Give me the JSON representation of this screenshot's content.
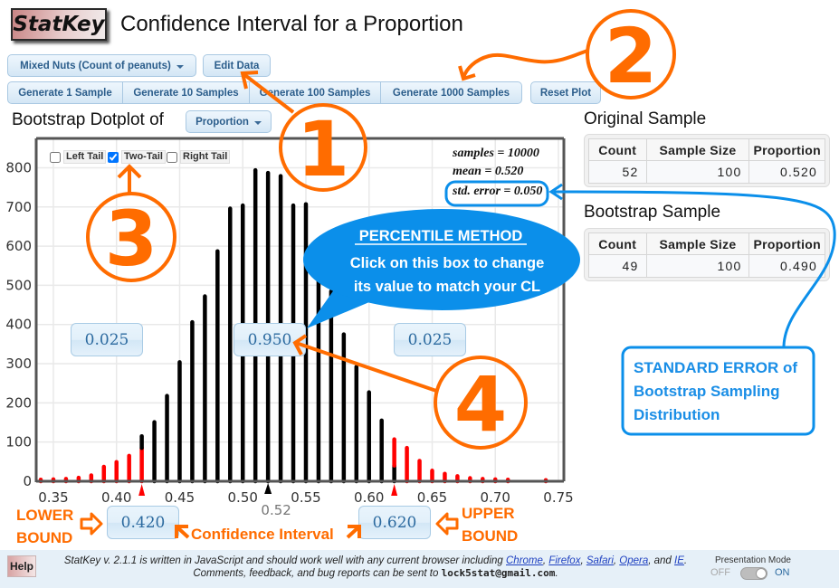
{
  "header": {
    "logo": "StatKey",
    "title": "Confidence Interval for a Proportion"
  },
  "toolbar": {
    "dataset": "Mixed Nuts (Count of peanuts)",
    "edit_data": "Edit Data",
    "generate": [
      "Generate 1 Sample",
      "Generate 10 Samples",
      "Generate 100 Samples",
      "Generate 1000 Samples"
    ],
    "reset_plot": "Reset Plot"
  },
  "plot_header": {
    "label": "Bootstrap Dotplot of",
    "statistic": "Proportion"
  },
  "tail_options": [
    {
      "label": "Left Tail",
      "checked": false
    },
    {
      "label": "Two-Tail",
      "checked": true
    },
    {
      "label": "Right Tail",
      "checked": false
    }
  ],
  "stats": {
    "samples": "samples = 10000",
    "mean": "mean = 0.520",
    "std_error": "std. error = 0.050"
  },
  "interval_boxes": {
    "left_tail": "0.025",
    "center": "0.950",
    "right_tail": "0.025",
    "lower_bound": "0.420",
    "upper_bound": "0.620"
  },
  "original_sample": {
    "title": "Original Sample",
    "headers": [
      "Count",
      "Sample Size",
      "Proportion"
    ],
    "values": [
      "52",
      "100",
      "0.520"
    ]
  },
  "bootstrap_sample": {
    "title": "Bootstrap Sample",
    "headers": [
      "Count",
      "Sample Size",
      "Proportion"
    ],
    "values": [
      "49",
      "100",
      "0.490"
    ]
  },
  "annotations": {
    "step_numbers": [
      "1",
      "2",
      "3",
      "4"
    ],
    "bubble_title": "PERCENTILE METHOD",
    "bubble_lines": [
      "Click on this box to change",
      "its value to match your CL"
    ],
    "se_callout": [
      "STANDARD ERROR of",
      "Bootstrap Sampling",
      "Distribution"
    ],
    "lower_bound": [
      "LOWER",
      "BOUND"
    ],
    "upper_bound": [
      "UPPER",
      "BOUND"
    ],
    "confidence_interval": "Confidence Interval"
  },
  "footer": {
    "help": "Help",
    "line1_prefix": "StatKey v. 2.1.1 is written in JavaScript and should work well with any current browser including ",
    "browsers": [
      "Chrome",
      "Firefox",
      "Safari",
      "Opera",
      "IE"
    ],
    "sep": ", ",
    "last_sep": ", and ",
    "end": ".",
    "line2_prefix": "Comments, feedback, and bug reports can be sent to ",
    "email": "lock5stat@gmail.com",
    "presentation_mode_label": "Presentation Mode",
    "off_label": "OFF",
    "on_label": "ON",
    "presentation_mode": "off"
  },
  "colors": {
    "annotation_orange": "#ff6c00",
    "callout_blue": "#0b8fea",
    "tail_red": "#ff0000",
    "interval_black": "#000000",
    "button_text": "#2b5d8b"
  },
  "chart_data": {
    "type": "bar",
    "subtype": "dotplot",
    "title": "Bootstrap Dotplot of Proportion",
    "xlabel": "",
    "ylabel": "",
    "xlim": [
      0.3364,
      0.7543
    ],
    "ylim": [
      0,
      875
    ],
    "grid": true,
    "x_ticks": [
      0.35,
      0.4,
      0.45,
      0.5,
      0.55,
      0.6,
      0.65,
      0.7,
      0.75
    ],
    "x_tick_labels": [
      "0.35",
      "0.40",
      "0.45",
      "0.50",
      "0.55",
      "0.60",
      "0.65",
      "0.70",
      "0.75"
    ],
    "y_ticks": [
      0,
      100,
      200,
      300,
      400,
      500,
      600,
      700,
      800
    ],
    "y_tick_labels": [
      "0",
      "100",
      "200",
      "300",
      "400",
      "500",
      "600",
      "700",
      "800"
    ],
    "mean_marker": 0.52,
    "mean_label": "0.52",
    "interval": [
      0.42,
      0.62
    ],
    "tail_mode": "two-tail",
    "bars_note": "count = dots stacked at each bootstrap proportion; tail = dots colored red (outside the 95% interval)",
    "bars": [
      {
        "x": 0.34,
        "count": 4,
        "tail": 4
      },
      {
        "x": 0.35,
        "count": 5,
        "tail": 5
      },
      {
        "x": 0.36,
        "count": 6,
        "tail": 6
      },
      {
        "x": 0.37,
        "count": 9,
        "tail": 9
      },
      {
        "x": 0.38,
        "count": 15,
        "tail": 15
      },
      {
        "x": 0.39,
        "count": 37,
        "tail": 37
      },
      {
        "x": 0.4,
        "count": 49,
        "tail": 49
      },
      {
        "x": 0.41,
        "count": 65,
        "tail": 65
      },
      {
        "x": 0.42,
        "count": 115,
        "tail": 85
      },
      {
        "x": 0.43,
        "count": 151,
        "tail": 0
      },
      {
        "x": 0.44,
        "count": 218,
        "tail": 0
      },
      {
        "x": 0.45,
        "count": 304,
        "tail": 0
      },
      {
        "x": 0.46,
        "count": 406,
        "tail": 0
      },
      {
        "x": 0.47,
        "count": 472,
        "tail": 0
      },
      {
        "x": 0.48,
        "count": 587,
        "tail": 0
      },
      {
        "x": 0.49,
        "count": 696,
        "tail": 0
      },
      {
        "x": 0.5,
        "count": 704,
        "tail": 0
      },
      {
        "x": 0.51,
        "count": 794,
        "tail": 0
      },
      {
        "x": 0.52,
        "count": 787,
        "tail": 0
      },
      {
        "x": 0.53,
        "count": 779,
        "tail": 0
      },
      {
        "x": 0.54,
        "count": 704,
        "tail": 0
      },
      {
        "x": 0.55,
        "count": 707,
        "tail": 0
      },
      {
        "x": 0.56,
        "count": 580,
        "tail": 0
      },
      {
        "x": 0.57,
        "count": 485,
        "tail": 0
      },
      {
        "x": 0.58,
        "count": 375,
        "tail": 0
      },
      {
        "x": 0.59,
        "count": 292,
        "tail": 0
      },
      {
        "x": 0.6,
        "count": 227,
        "tail": 0
      },
      {
        "x": 0.61,
        "count": 155,
        "tail": 0
      },
      {
        "x": 0.62,
        "count": 107,
        "tail": 67
      },
      {
        "x": 0.63,
        "count": 85,
        "tail": 85
      },
      {
        "x": 0.64,
        "count": 52,
        "tail": 52
      },
      {
        "x": 0.65,
        "count": 27,
        "tail": 27
      },
      {
        "x": 0.66,
        "count": 19,
        "tail": 19
      },
      {
        "x": 0.67,
        "count": 13,
        "tail": 13
      },
      {
        "x": 0.68,
        "count": 8,
        "tail": 8
      },
      {
        "x": 0.69,
        "count": 6,
        "tail": 6
      },
      {
        "x": 0.7,
        "count": 5,
        "tail": 5
      },
      {
        "x": 0.71,
        "count": 4,
        "tail": 4
      },
      {
        "x": 0.74,
        "count": 3,
        "tail": 3
      }
    ]
  }
}
